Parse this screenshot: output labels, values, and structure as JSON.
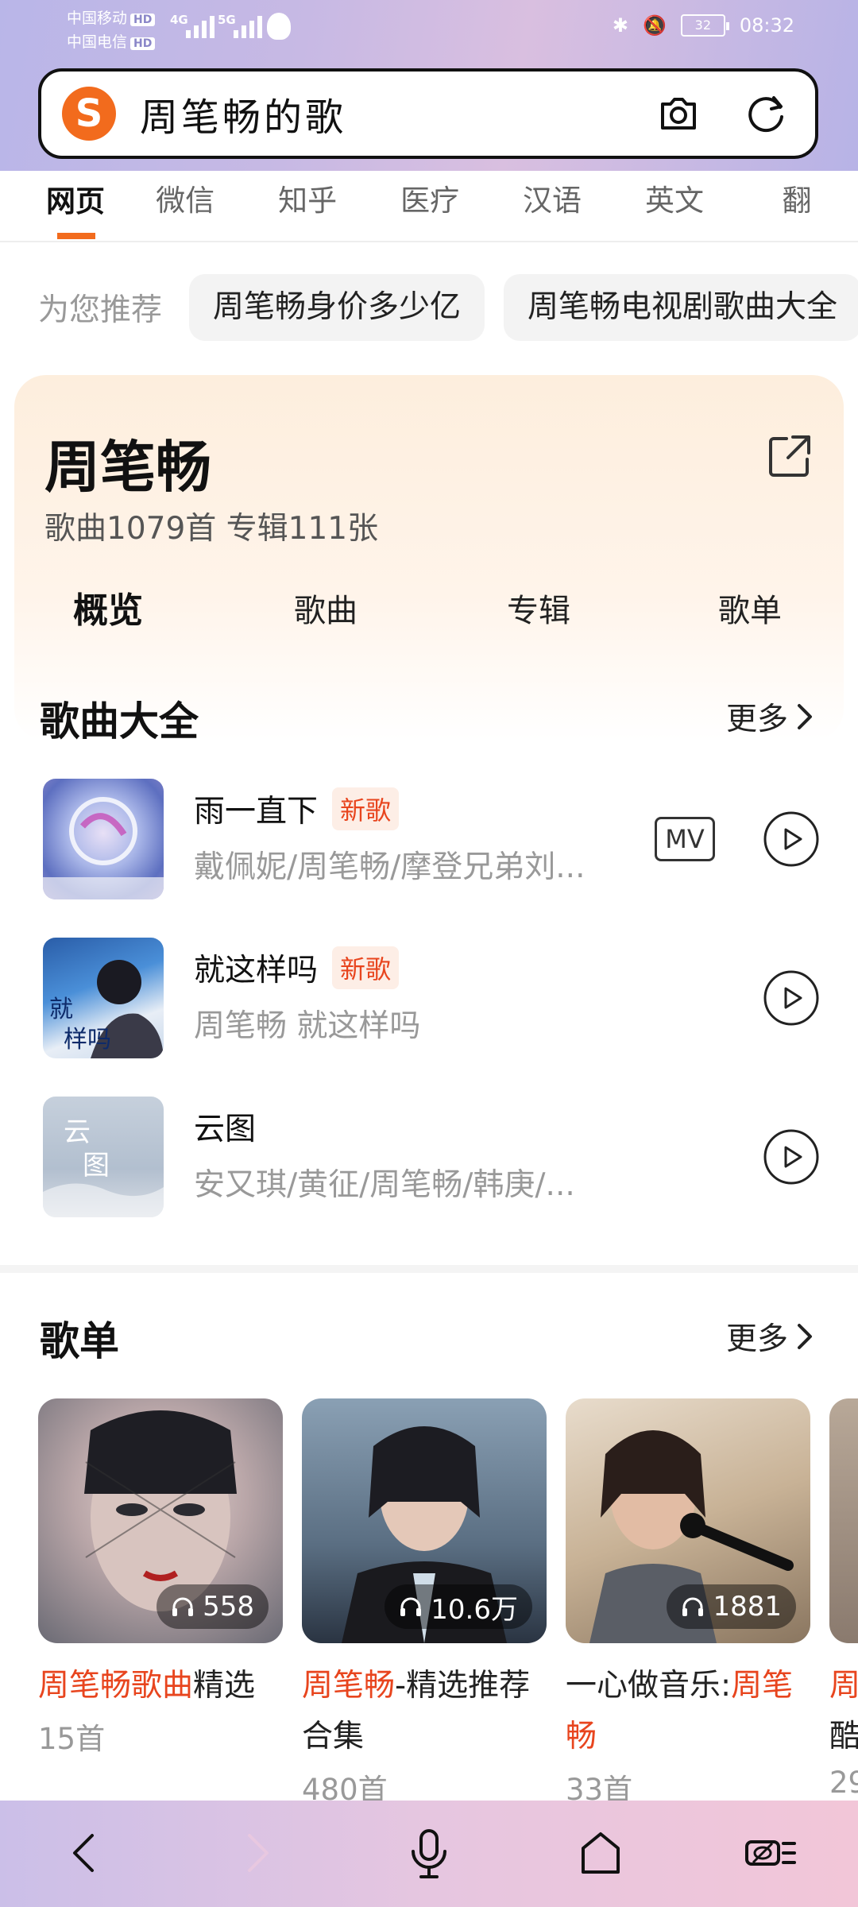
{
  "status_bar": {
    "carrier_1": "中国移动",
    "carrier_2": "中国电信",
    "hd": "HD",
    "net_1": "4G",
    "net_2": "5G",
    "battery": "32",
    "time": "08:32"
  },
  "search": {
    "query": "周笔畅的歌"
  },
  "tabs": [
    "网页",
    "微信",
    "知乎",
    "医疗",
    "汉语",
    "英文",
    "翻"
  ],
  "recommend": {
    "label": "为您推荐",
    "chips": [
      "周笔畅身价多少亿",
      "周笔畅电视剧歌曲大全"
    ]
  },
  "artist": {
    "name": "周笔畅",
    "stats": "歌曲1079首  专辑111张",
    "tabs": [
      "概览",
      "歌曲",
      "专辑",
      "歌单"
    ]
  },
  "songs_section": {
    "title": "歌曲大全",
    "more": "更多"
  },
  "songs": [
    {
      "title": "雨一直下",
      "badge": "新歌",
      "artists": "戴佩妮/周笔畅/摩登兄弟刘...",
      "mv": "MV"
    },
    {
      "title": "就这样吗",
      "badge": "新歌",
      "artists": "周笔畅  就这样吗"
    },
    {
      "title": "云图",
      "artists": "安又琪/黄征/周笔畅/韩庚/..."
    }
  ],
  "playlists_section": {
    "title": "歌单",
    "more": "更多"
  },
  "playlists": [
    {
      "count": "558",
      "title_hl": "周笔畅歌曲",
      "title_rest": "精选",
      "sub": "15首"
    },
    {
      "count": "10.6万",
      "title_hl": "周笔畅",
      "title_rest": "-精选推荐合集",
      "sub": "480首"
    },
    {
      "count": "1881",
      "title_pre": "一心做音乐:",
      "title_hl": "周笔畅",
      "sub": "33首"
    },
    {
      "title_hl": "周",
      "title_rest": "酷",
      "sub": "29"
    }
  ],
  "colors": {
    "accent": "#f26b1d",
    "highlight_red": "#e8451e"
  }
}
